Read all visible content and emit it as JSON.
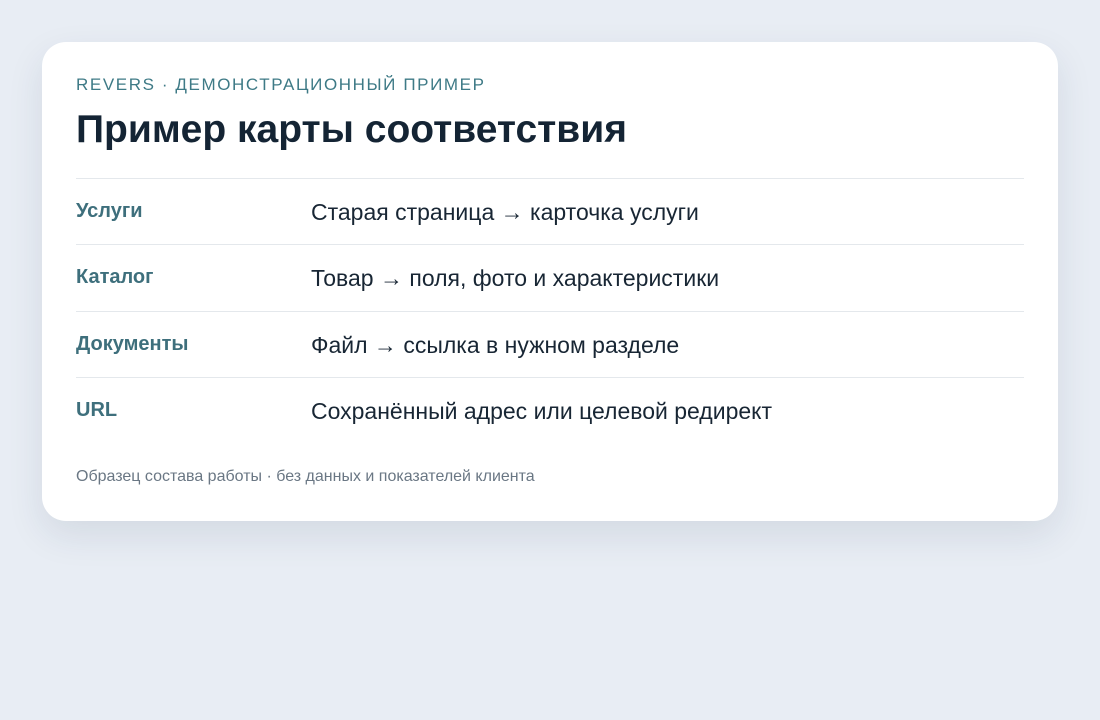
{
  "card": {
    "eyebrow": "REVERS · ДЕМОНСТРАЦИОННЫЙ ПРИМЕР",
    "title": "Пример карты соответствия",
    "rows": [
      {
        "label": "Услуги",
        "value": "Старая страница → карточка услуги"
      },
      {
        "label": "Каталог",
        "value": "Товар → поля, фото и характеристики"
      },
      {
        "label": "Документы",
        "value": "Файл → ссылка в нужном разделе"
      },
      {
        "label": "URL",
        "value": "Сохранённый адрес или целевой редирект"
      }
    ],
    "footnote": "Образец состава работы · без данных и показателей клиента"
  },
  "colors": {
    "background": "#e8edf4",
    "card": "#ffffff",
    "accent": "#3e7a86",
    "heading": "#142434",
    "muted": "#6a7784"
  }
}
